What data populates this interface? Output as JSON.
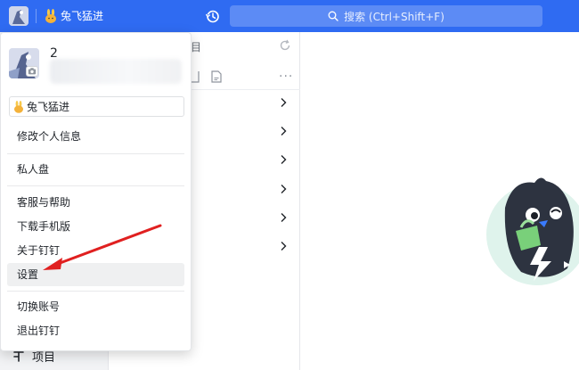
{
  "titlebar": {
    "org_name": "兔飞猛进",
    "search_placeholder": "搜索 (Ctrl+Shift+F)",
    "accent_color": "#2f6bf2"
  },
  "middle": {
    "header_fragment": "目"
  },
  "leftnav": {
    "project_label": "项目"
  },
  "user_menu": {
    "user_name": "2",
    "org_chip_label": "兔飞猛进",
    "items": [
      {
        "label": "修改个人信息"
      },
      {
        "label": "私人盘"
      },
      {
        "label": "客服与帮助"
      },
      {
        "label": "下载手机版"
      },
      {
        "label": "关于钉钉"
      },
      {
        "label": "设置",
        "highlighted": true
      },
      {
        "label": "切换账号"
      },
      {
        "label": "退出钉钉"
      }
    ]
  },
  "annotation": {
    "arrow_color": "#e02020",
    "points_to": "设置"
  }
}
